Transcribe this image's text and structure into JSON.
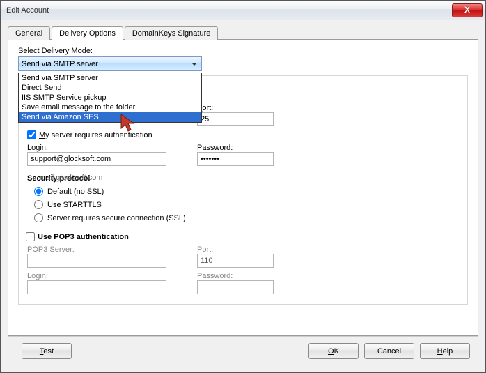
{
  "window": {
    "title": "Edit Account",
    "close_symbol": "X"
  },
  "tabs": {
    "general": "General",
    "delivery": "Delivery Options",
    "domainkeys": "DomainKeys Signature"
  },
  "delivery": {
    "select_label": "Select Delivery Mode:",
    "selected": "Send via SMTP server",
    "options": [
      "Send via SMTP server",
      "Direct Send",
      "IIS SMTP Service pickup",
      "Save email message to the folder",
      "Send via Amazon SES"
    ]
  },
  "smtp": {
    "server_value_peek": "mail.glocksoft.com",
    "port_label": "Port:",
    "port_value": "25",
    "auth_label": "My server requires authentication",
    "login_label": "Login:",
    "login_value": "support@glocksoft.com",
    "password_label": "Password:",
    "password_value": "xxxxxxx"
  },
  "security": {
    "title": "Security protocol",
    "default": "Default (no SSL)",
    "starttls": "Use STARTTLS",
    "ssl": "Server requires secure connection (SSL)"
  },
  "pop3": {
    "title": "Use POP3 authentication",
    "server_label": "POP3 Server:",
    "port_label": "Port:",
    "port_value": "110",
    "login_label": "Login:",
    "password_label": "Password:"
  },
  "buttons": {
    "test": "Test",
    "ok": "OK",
    "cancel": "Cancel",
    "help": "Help"
  }
}
